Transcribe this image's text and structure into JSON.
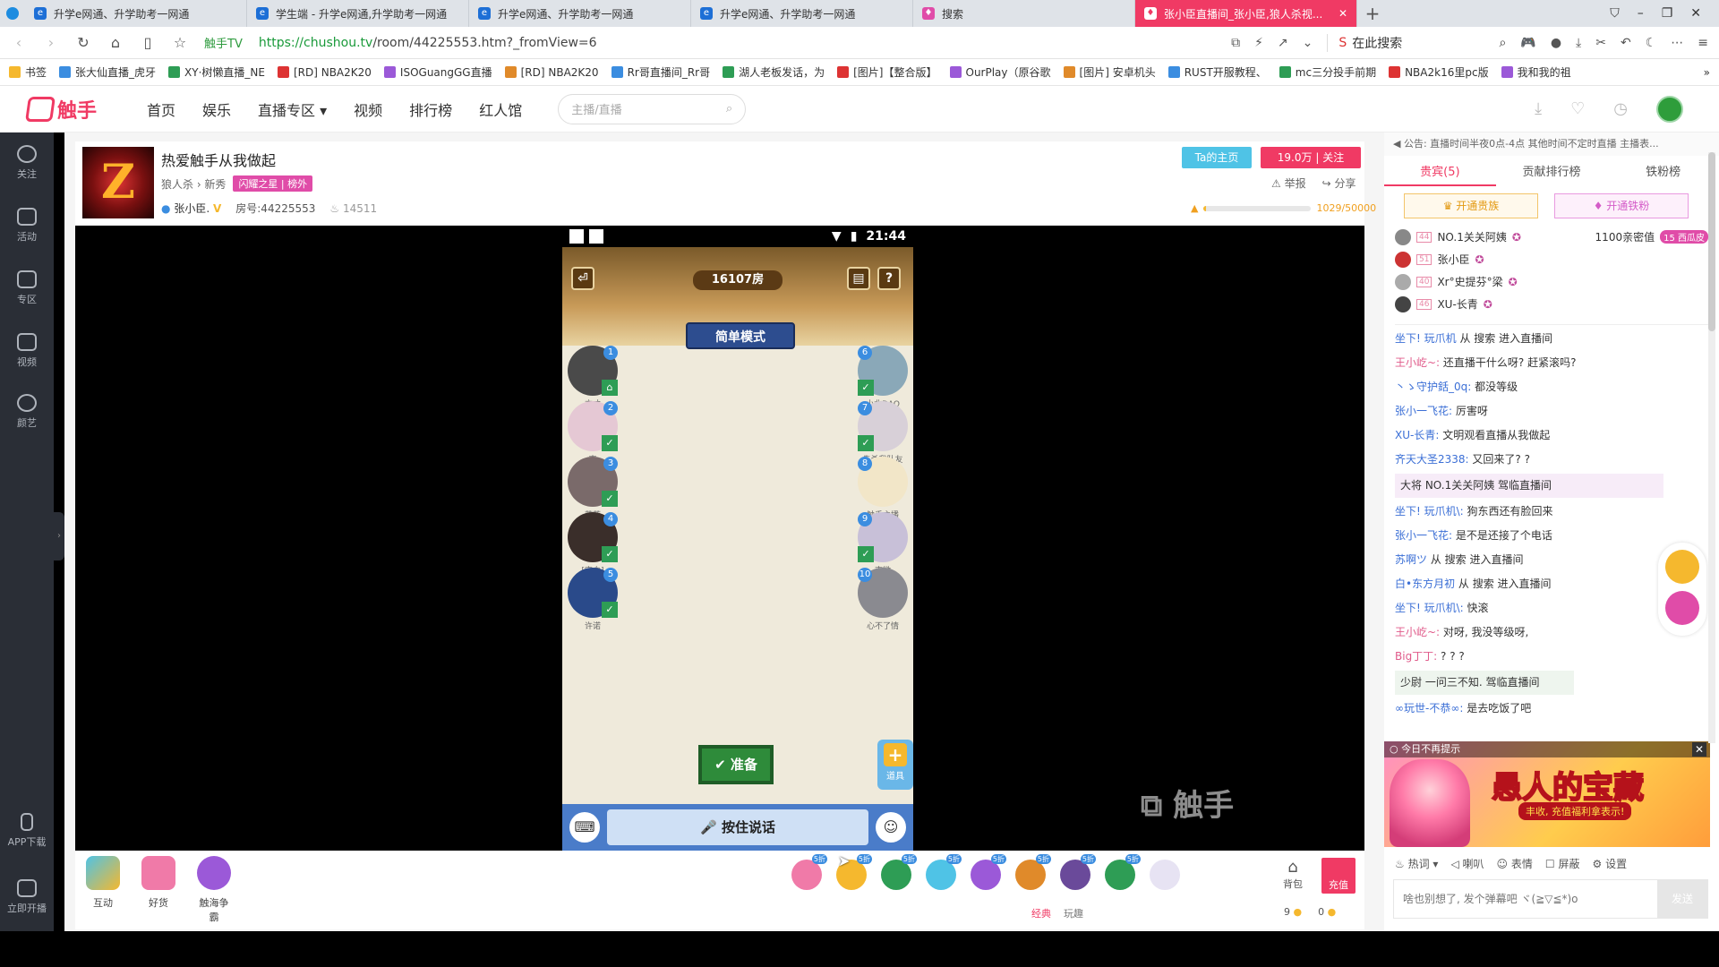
{
  "browser": {
    "tabs": [
      {
        "title": "升学e网通、升学助考一网通"
      },
      {
        "title": "学生端 - 升学e网通,升学助考一网通"
      },
      {
        "title": "升学e网通、升学助考一网通"
      },
      {
        "title": "升学e网通、升学助考一网通"
      },
      {
        "title": "搜索"
      },
      {
        "title": "张小臣直播间_张小臣,狼人杀视..."
      }
    ],
    "site_badge": "触手TV",
    "url_prefix": "https://chushou.tv",
    "url_path": "/room/44225553.htm?_fromView=6",
    "search_placeholder": "在此搜索",
    "bookmarks": [
      "书签",
      "张大仙直播_虎牙",
      "XY·树懒直播_NE",
      "[RD] NBA2K20",
      "ISOGuangGG直播",
      "[RD] NBA2K20",
      "Rr哥直播间_Rr哥",
      "湖人老板发话，为",
      "[图片]【整合版】",
      "OurPlay（原谷歌",
      "[图片] 安卓机头",
      "RUST开服教程、",
      "mc三分投手前期",
      "NBA2k16里pc版",
      "我和我的祖"
    ]
  },
  "site": {
    "brand": "触手",
    "nav": [
      "首页",
      "娱乐",
      "直播专区 ▾",
      "视频",
      "排行榜",
      "红人馆"
    ],
    "search_placeholder": "主播/直播"
  },
  "rail": [
    "关注",
    "活动",
    "专区",
    "视频",
    "颜艺",
    "APP下载",
    "立即开播"
  ],
  "room": {
    "title": "热爱触手从我做起",
    "category": "狼人杀 › 新秀",
    "tag": "闪耀之星 | 榜外",
    "host": "张小臣.",
    "room_id": "房号:44225553",
    "popularity": "14511",
    "ta_home": "Ta的主页",
    "followers": "19.0万",
    "follow": "关注",
    "report": "举报",
    "share": "分享",
    "level_progress": "1029/50000",
    "level_ratio": 0.02058
  },
  "game": {
    "time": "21:44",
    "room_number": "16107房",
    "mode": "简单模式",
    "seats_left": [
      {
        "num": "1",
        "name": "方才",
        "ok": "⌂"
      },
      {
        "num": "2",
        "name": "南",
        "ok": "✓"
      },
      {
        "num": "3",
        "name": "蓝蓝",
        "ok": "✓"
      },
      {
        "num": "4",
        "name": "[空白]",
        "ok": "✓"
      },
      {
        "num": "5",
        "name": "许诺",
        "ok": "✓"
      }
    ],
    "seats_right": [
      {
        "num": "6",
        "name": "小北DAO",
        "ok": "✓"
      },
      {
        "num": "7",
        "name": "先杀我队友",
        "ok": "✓"
      },
      {
        "num": "8",
        "name": "触手主播",
        "ok": ""
      },
      {
        "num": "9",
        "name": "南微",
        "ok": "✓"
      },
      {
        "num": "10",
        "name": "心不了情",
        "ok": ""
      }
    ],
    "ready": "✔ 准备",
    "props": "道具",
    "talk": "按住说话"
  },
  "watermark": "触手",
  "giftbar": {
    "left": [
      "互动",
      "好货",
      "触海争霸"
    ],
    "gift_badges": [
      "5折",
      "5折",
      "5折",
      "5折",
      "5折",
      "5折",
      "5折",
      "5折"
    ],
    "bag": "背包",
    "recharge": "充值",
    "tabs": [
      "经典",
      "玩趣"
    ],
    "counts": [
      "9",
      "0"
    ]
  },
  "sidebar": {
    "notice": "公告: 直播时间半夜0点-4点 其他时间不定时直播 主播表...",
    "tabs": [
      "贵宾(5)",
      "贡献排行榜",
      "铁粉榜"
    ],
    "vip_btn": "开通贵族",
    "fan_btn": "开通铁粉",
    "vips": [
      {
        "lv": "44",
        "name": "NO.1关关阿姨",
        "aff": "1100亲密值",
        "fan": "15 西瓜皮"
      },
      {
        "lv": "51",
        "name": "张小臣",
        "aff": "",
        "fan": ""
      },
      {
        "lv": "40",
        "name": "Xr°史提芬°梁",
        "aff": "",
        "fan": ""
      },
      {
        "lv": "46",
        "name": "XU-长青",
        "aff": "",
        "fan": ""
      }
    ],
    "chat": [
      {
        "user": "坐下! 玩爪机",
        "text": " 从 搜索 进入直播间"
      },
      {
        "user": "王小屹~:",
        "text": " 还直播干什么呀? 赶紧滚吗?"
      },
      {
        "user": "丶ゝ守护銛_0q:",
        "text": " 都没等级"
      },
      {
        "user": "张小一飞花:",
        "text": " 厉害呀"
      },
      {
        "user": "XU-长青:",
        "text": " 文明观看直播从我做起"
      },
      {
        "user": "齐天大圣2338:",
        "text": " 又回来了? ?"
      },
      {
        "user": "",
        "text": "大将 NO.1关关阿姨 驾临直播间"
      },
      {
        "user": "坐下! 玩爪机\\:",
        "text": " 狗东西还有脸回来"
      },
      {
        "user": "张小一飞花:",
        "text": " 是不是还接了个电话"
      },
      {
        "user": "苏啊ツ",
        "text": " 从 搜索 进入直播间"
      },
      {
        "user": "白•东方月初",
        "text": " 从 搜索 进入直播间"
      },
      {
        "user": "坐下! 玩爪机\\:",
        "text": " 快滚"
      },
      {
        "user": "王小屹~:",
        "text": " 对呀, 我没等级呀,"
      },
      {
        "user": "Big丁丁:",
        "text": " ? ? ?"
      },
      {
        "user": "",
        "text": "少尉 一问三不知. 驾临直播间"
      },
      {
        "user": "∞玩世-不恭∞:",
        "text": " 是去吃饭了吧"
      }
    ],
    "ad": {
      "dismiss": "今日不再提示",
      "title": "愚人的宝藏",
      "sub": "丰收, 充值福利拿表示!"
    },
    "tools": [
      "热词 ▾",
      "喇叭",
      "表情",
      "屏蔽",
      "设置"
    ],
    "input_placeholder": "啥也别想了, 发个弹幕吧 ヾ(≧▽≦*)o",
    "send": "发送"
  }
}
